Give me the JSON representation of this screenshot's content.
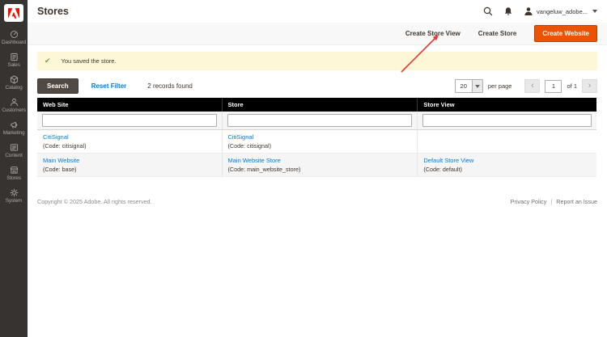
{
  "colors": {
    "accent_orange": "#eb5202",
    "link_blue": "#007bdb",
    "success_green": "#79a22e",
    "message_bg": "#fdf7d8",
    "sidebar_bg": "#373330",
    "grid_header_bg": "#000000",
    "annotation_red": "#e8382f"
  },
  "icons": [
    "adobe-logo",
    "dashboard-icon",
    "sales-icon",
    "catalog-icon",
    "customers-icon",
    "marketing-icon",
    "content-icon",
    "stores-icon",
    "system-icon",
    "search-icon",
    "bell-icon",
    "user-icon",
    "caret-down-icon",
    "checkmark-icon"
  ],
  "sidebar": {
    "items": [
      {
        "label": "Dashboard",
        "icon": "dashboard-icon"
      },
      {
        "label": "Sales",
        "icon": "sales-icon"
      },
      {
        "label": "Catalog",
        "icon": "catalog-icon"
      },
      {
        "label": "Customers",
        "icon": "customers-icon"
      },
      {
        "label": "Marketing",
        "icon": "marketing-icon"
      },
      {
        "label": "Content",
        "icon": "content-icon"
      },
      {
        "label": "Stores",
        "icon": "stores-icon"
      },
      {
        "label": "System",
        "icon": "system-icon"
      }
    ]
  },
  "header": {
    "title": "Stores",
    "username": "vangeluw_adobe..."
  },
  "toolbar": {
    "create_store_view_label": "Create Store View",
    "create_store_label": "Create Store",
    "create_website_label": "Create Website"
  },
  "message": {
    "text": "You saved the store."
  },
  "grid_controls": {
    "search_label": "Search",
    "reset_filter_label": "Reset Filter",
    "records_found": "2 records found",
    "per_page_value": "20",
    "per_page_label": "per page",
    "prev_label": "‹",
    "page_value": "1",
    "of_label": "of 1",
    "next_label": "›"
  },
  "table": {
    "columns": [
      "Web Site",
      "Store",
      "Store View"
    ],
    "rows": [
      {
        "website": {
          "name": "CitiSignal",
          "code": "(Code: citisignal)"
        },
        "store": {
          "name": "CitiSignal",
          "code": "(Code: citisignal)"
        },
        "store_view": {
          "name": "",
          "code": ""
        }
      },
      {
        "website": {
          "name": "Main Website",
          "code": "(Code: base)"
        },
        "store": {
          "name": "Main Website Store",
          "code": "(Code: main_website_store)"
        },
        "store_view": {
          "name": "Default Store View",
          "code": "(Code: default)"
        }
      }
    ]
  },
  "footer": {
    "copyright": "Copyright © 2025 Adobe. All rights reserved.",
    "privacy_label": "Privacy Policy",
    "separator": "|",
    "report_label": "Report an Issue"
  }
}
